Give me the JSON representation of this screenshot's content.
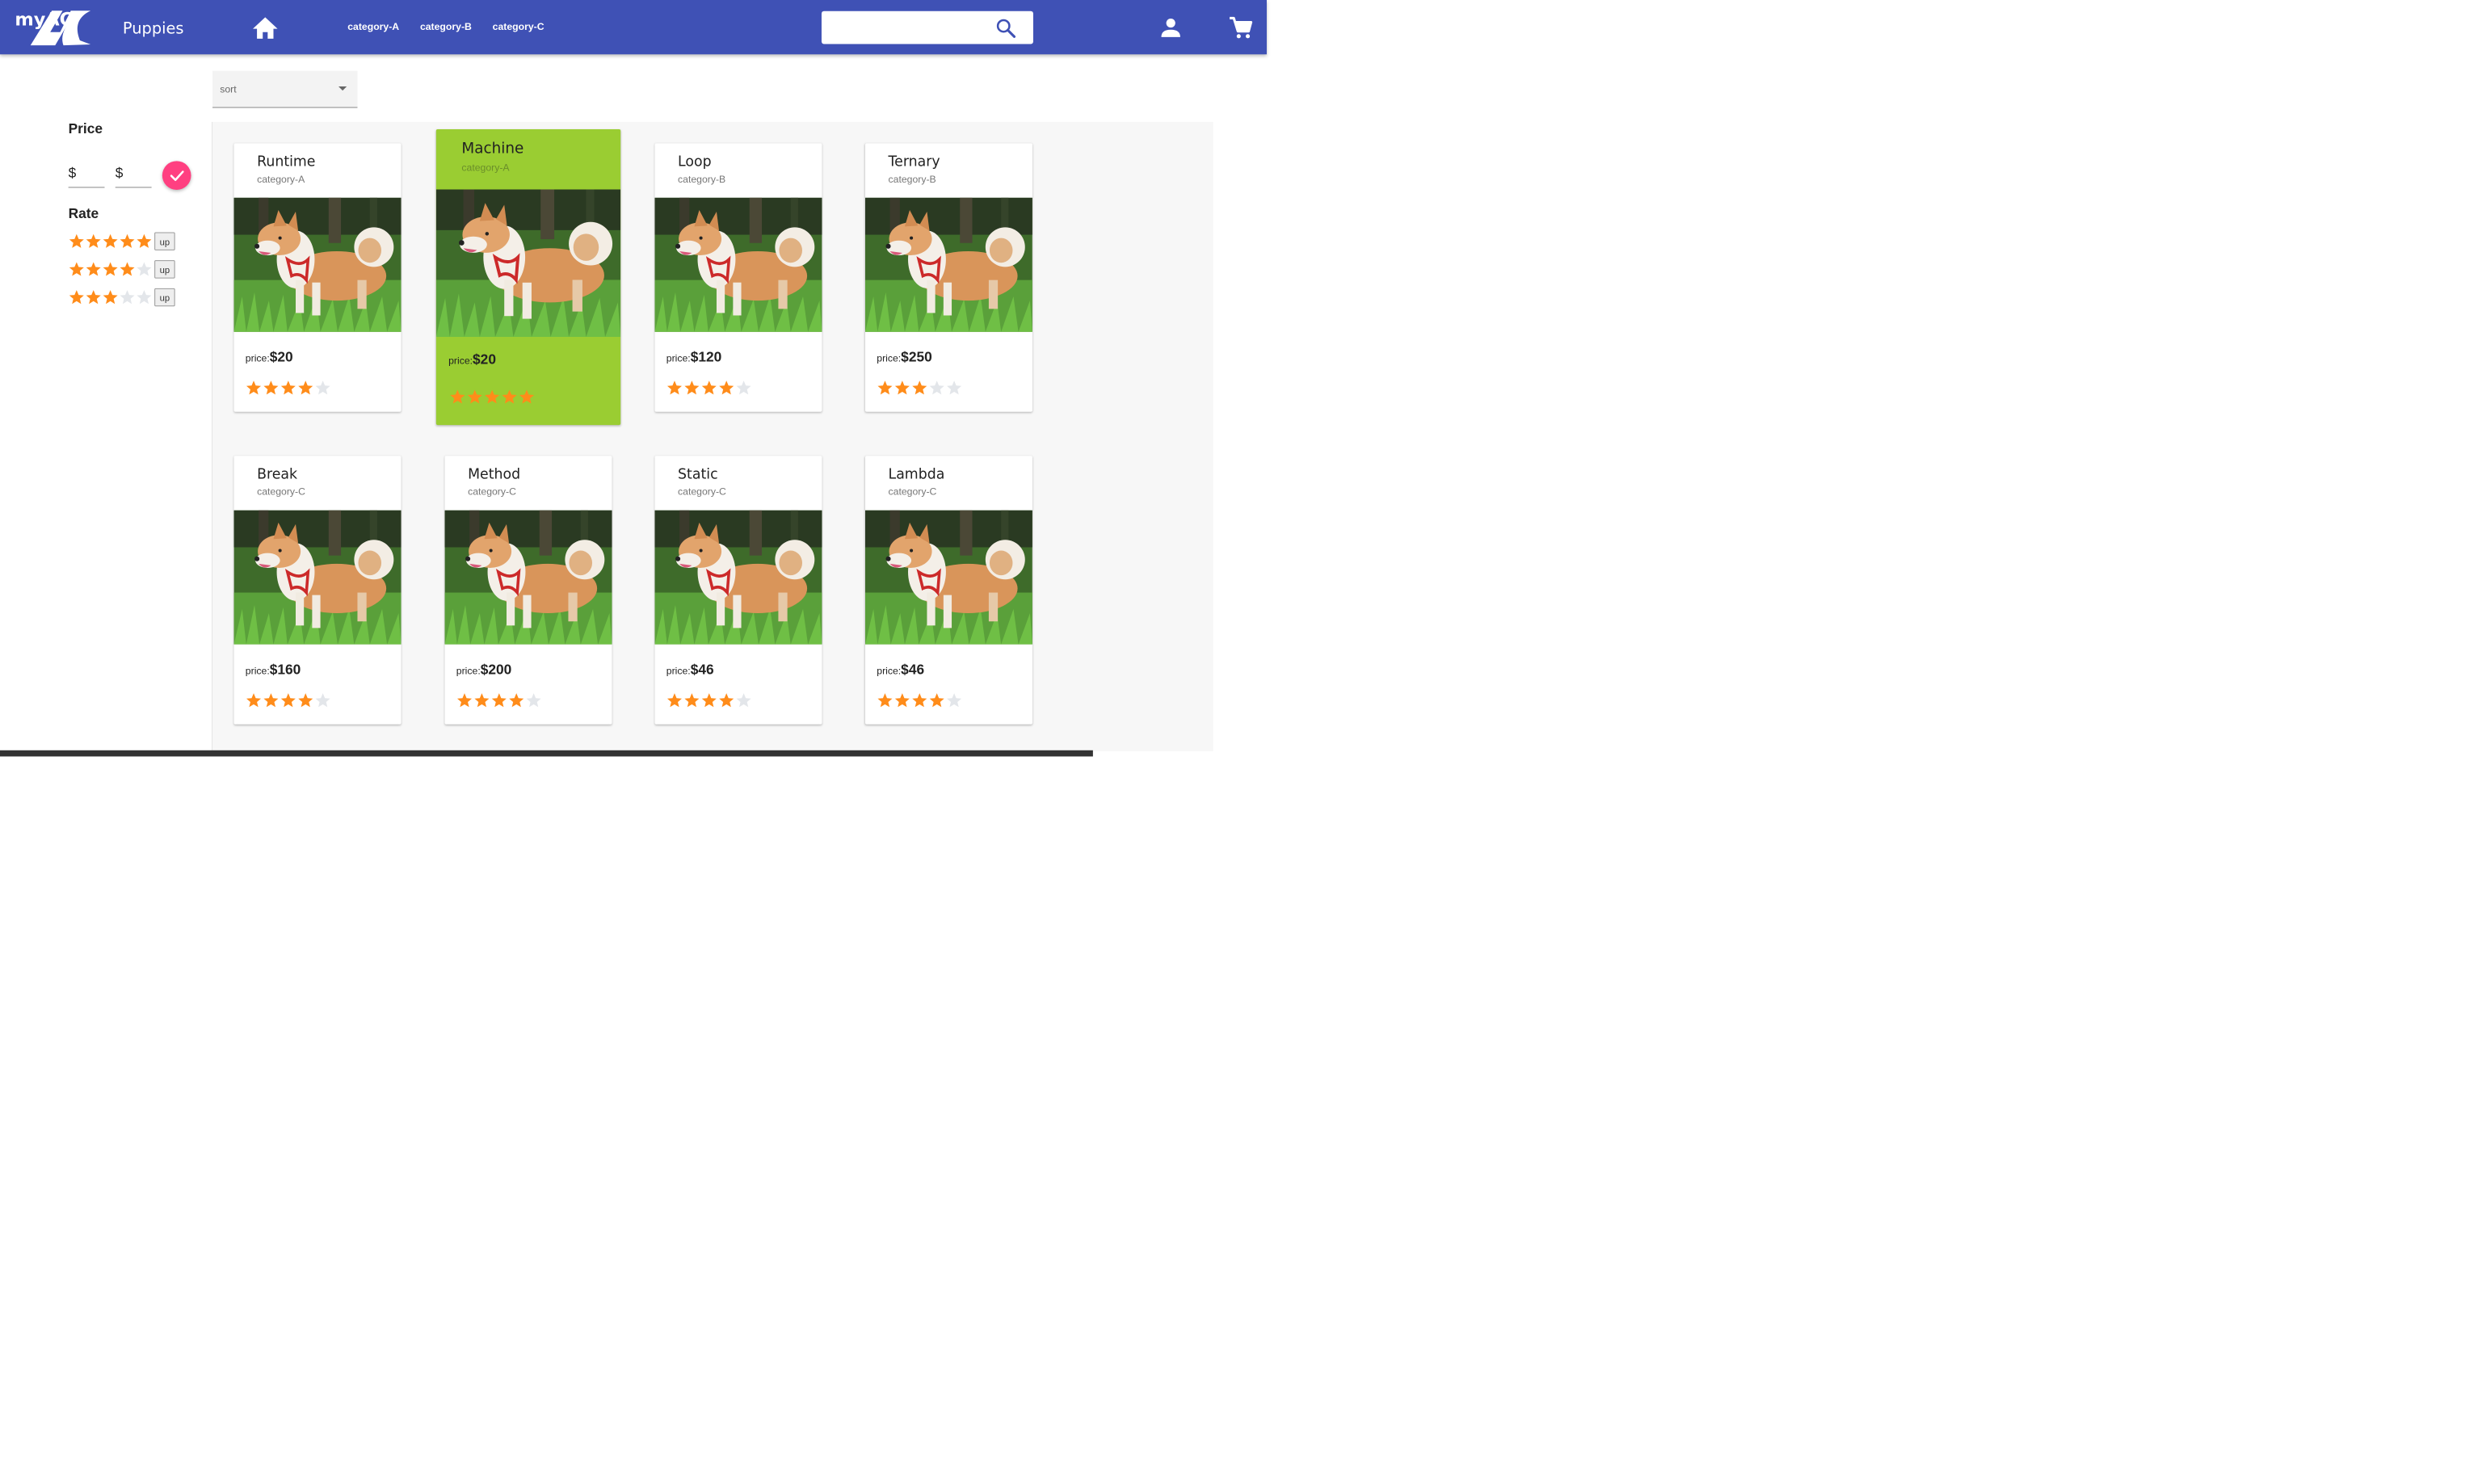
{
  "header": {
    "logo_text": "myAC",
    "brand": "Puppies",
    "nav": [
      "category-A",
      "category-B",
      "category-C"
    ],
    "search": {
      "value": "",
      "placeholder": ""
    },
    "icons": {
      "home": "home-icon",
      "search": "search-icon",
      "user": "user-icon",
      "cart": "cart-icon"
    }
  },
  "sort": {
    "label": "sort"
  },
  "filters": {
    "price_title": "Price",
    "currency_min": "$",
    "currency_max": "$",
    "rate_title": "Rate",
    "rate_rows": [
      {
        "stars": 5,
        "button": "up"
      },
      {
        "stars": 4,
        "button": "up"
      },
      {
        "stars": 3,
        "button": "up"
      }
    ]
  },
  "products": [
    {
      "title": "Runtime",
      "category": "category-A",
      "price_label": "price:",
      "price": "$20",
      "rating": 4,
      "highlighted": false
    },
    {
      "title": "Machine",
      "category": "category-A",
      "price_label": "price:",
      "price": "$20",
      "rating": 5,
      "highlighted": true
    },
    {
      "title": "Loop",
      "category": "category-B",
      "price_label": "price:",
      "price": "$120",
      "rating": 4,
      "highlighted": false
    },
    {
      "title": "Ternary",
      "category": "category-B",
      "price_label": "price:",
      "price": "$250",
      "rating": 3,
      "highlighted": false
    },
    {
      "title": "Break",
      "category": "category-C",
      "price_label": "price:",
      "price": "$160",
      "rating": 4,
      "highlighted": false
    },
    {
      "title": "Method",
      "category": "category-C",
      "price_label": "price:",
      "price": "$200",
      "rating": 4,
      "highlighted": false
    },
    {
      "title": "Static",
      "category": "category-C",
      "price_label": "price:",
      "price": "$46",
      "rating": 4,
      "highlighted": false
    },
    {
      "title": "Lambda",
      "category": "category-C",
      "price_label": "price:",
      "price": "$46",
      "rating": 4,
      "highlighted": false
    }
  ],
  "colors": {
    "header": "#3f51b5",
    "accent": "#ff4081",
    "star_on": "#ff8c1a",
    "star_off": "#e3e6ea",
    "highlight_card": "#9acd32"
  }
}
